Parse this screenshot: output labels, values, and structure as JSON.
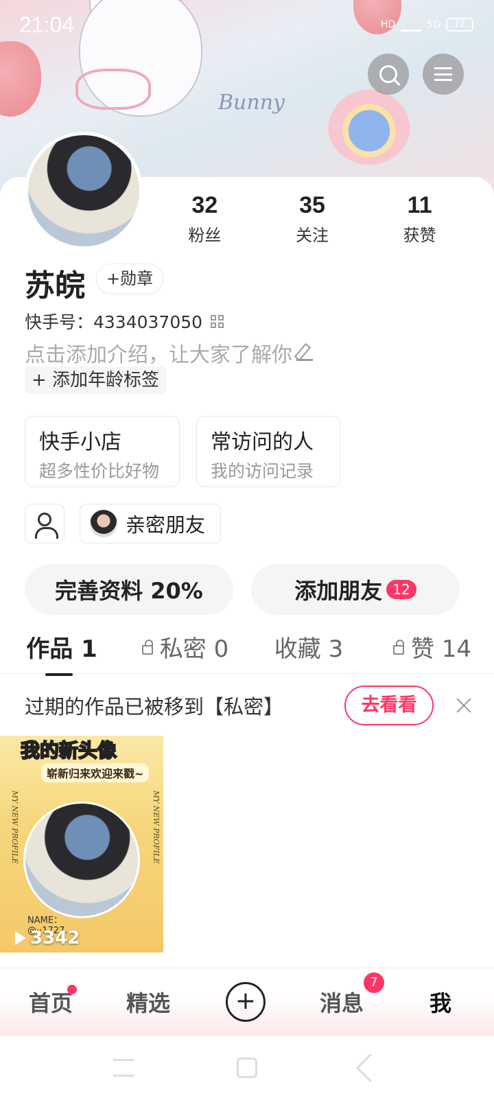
{
  "status_bar": {
    "time": "21:04",
    "network": "5G",
    "hd": "HD",
    "battery": "12"
  },
  "banner": {
    "text": "Bunny"
  },
  "profile": {
    "stats": [
      {
        "num": "32",
        "label": "粉丝"
      },
      {
        "num": "35",
        "label": "关注"
      },
      {
        "num": "11",
        "label": "获赞"
      }
    ],
    "name": "苏皖",
    "badge_label": "+勋章",
    "kuaishou_id": "快手号：4334037050",
    "intro_placeholder": "点击添加介绍，让大家了解你",
    "age_tag": "+ 添加年龄标签"
  },
  "tiles": [
    {
      "title": "快手小店",
      "subtitle": "超多性价比好物"
    },
    {
      "title": "常访问的人",
      "subtitle": "我的访问记录"
    }
  ],
  "intimate_label": "亲密朋友",
  "actions": {
    "complete_profile": "完善资料 20%",
    "add_friend": "添加朋友",
    "add_friend_badge": "12"
  },
  "tabs": [
    {
      "label": "作品 1"
    },
    {
      "label": "私密 0"
    },
    {
      "label": "收藏 3"
    },
    {
      "label": "赞 14"
    }
  ],
  "notice": {
    "text": "过期的作品已被移到【私密】",
    "button": "去看看"
  },
  "video": {
    "title": "我的新头像",
    "subtitle": "崭新归来欢迎来戳~",
    "side_text": "MY NEW PROFILE",
    "name_text": "NAME：",
    "handle": "@··1727...",
    "plays": "3342"
  },
  "bottom_nav": {
    "home": "首页",
    "featured": "精选",
    "plus": "+",
    "messages": "消息",
    "messages_badge": "7",
    "me": "我"
  },
  "colors": {
    "accent": "#fe3666",
    "text": "#222222",
    "muted": "#999999"
  }
}
